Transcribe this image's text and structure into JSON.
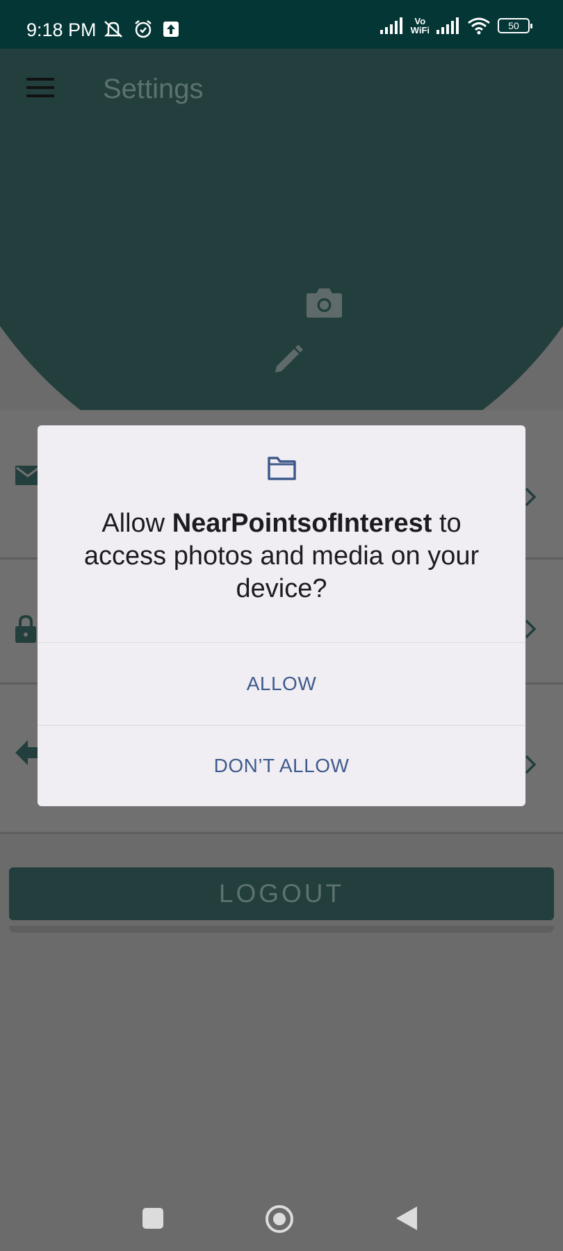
{
  "status_bar": {
    "time": "9:18 PM",
    "vowifi_top": "Vo",
    "vowifi_bottom": "WiFi",
    "battery": "50"
  },
  "app": {
    "title": "Settings",
    "logout_label": "LOGOUT",
    "accent_color": "#223f3d"
  },
  "dialog": {
    "message_prefix": "Allow ",
    "app_name": "NearPointsofInterest",
    "message_suffix": " to access photos and media on your device?",
    "allow_label": "ALLOW",
    "deny_label": "DON’T ALLOW",
    "icon": "folder-icon",
    "button_color": "#3f5a8c"
  },
  "nav_bar": {
    "icons": [
      "recents-icon",
      "home-icon",
      "back-icon"
    ]
  }
}
